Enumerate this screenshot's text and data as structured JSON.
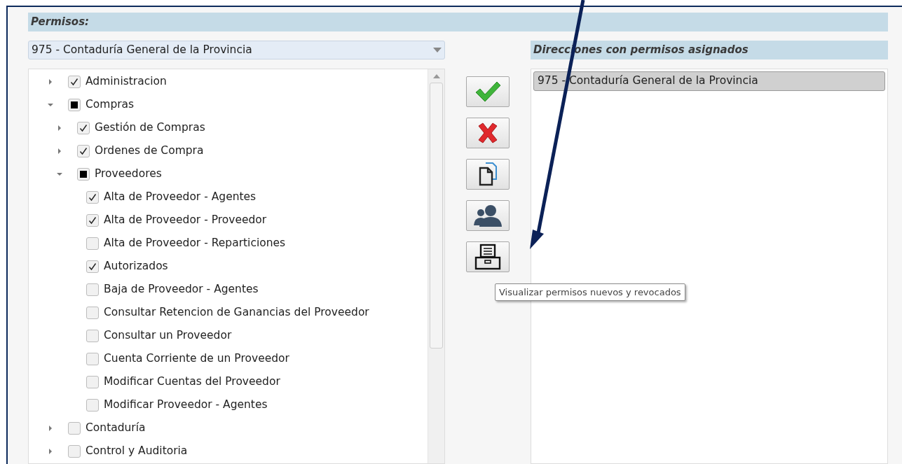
{
  "permissions_header": "Permisos:",
  "department_select": {
    "value": "975 - Contaduría General de la Provincia"
  },
  "tree": [
    {
      "label": "Administracion",
      "checked": true,
      "partial": false,
      "expanded": false
    },
    {
      "label": "Compras",
      "checked": false,
      "partial": true,
      "expanded": true,
      "children": [
        {
          "label": "Gestión de Compras",
          "checked": true,
          "partial": false,
          "expanded": false
        },
        {
          "label": "Ordenes de Compra",
          "checked": true,
          "partial": false,
          "expanded": false
        },
        {
          "label": "Proveedores",
          "checked": false,
          "partial": true,
          "expanded": true,
          "children": [
            {
              "label": "Alta de Proveedor - Agentes",
              "checked": true,
              "partial": false
            },
            {
              "label": "Alta de Proveedor - Proveedor",
              "checked": true,
              "partial": false
            },
            {
              "label": "Alta de Proveedor - Reparticiones",
              "checked": false,
              "partial": false
            },
            {
              "label": "Autorizados",
              "checked": true,
              "partial": false
            },
            {
              "label": "Baja de Proveedor - Agentes",
              "checked": false,
              "partial": false
            },
            {
              "label": "Consultar Retencion de Ganancias del Proveedor",
              "checked": false,
              "partial": false
            },
            {
              "label": "Consultar un Proveedor",
              "checked": false,
              "partial": false
            },
            {
              "label": "Cuenta Corriente de un Proveedor",
              "checked": false,
              "partial": false
            },
            {
              "label": "Modificar Cuentas del Proveedor",
              "checked": false,
              "partial": false
            },
            {
              "label": "Modificar Proveedor - Agentes",
              "checked": false,
              "partial": false
            }
          ]
        }
      ]
    },
    {
      "label": "Contaduría",
      "checked": false,
      "partial": false,
      "expanded": false
    },
    {
      "label": "Control y Auditoria",
      "checked": false,
      "partial": false,
      "expanded": false
    }
  ],
  "actions": [
    {
      "kind": "accept"
    },
    {
      "kind": "remove"
    },
    {
      "kind": "copy"
    },
    {
      "kind": "users"
    },
    {
      "kind": "archive"
    }
  ],
  "tooltip": "Visualizar permisos nuevos y revocados",
  "assigned_header": "Direcciones con permisos asignados",
  "assigned": [
    {
      "label": "975 - Contaduría General de la Provincia",
      "selected": true
    }
  ]
}
